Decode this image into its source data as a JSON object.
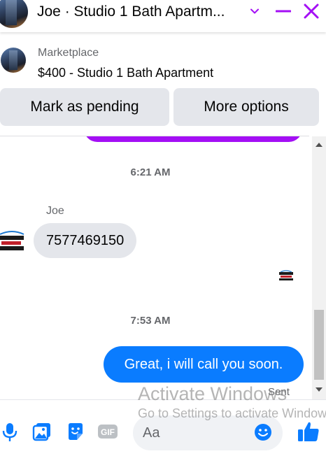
{
  "header": {
    "title": "Joe · Studio 1 Bath Apartm...",
    "accent_color": "#a40ff5"
  },
  "listing": {
    "kind": "Marketplace",
    "title": "$400 - Studio 1 Bath Apartment"
  },
  "actions": {
    "mark_pending": "Mark as pending",
    "more_options": "More options"
  },
  "chat": {
    "timestamp_1": "6:21 AM",
    "sender_name": "Joe",
    "received_message": "7577469150",
    "timestamp_2": "7:53 AM",
    "sent_message": "Great, i will call you soon.",
    "status": "Sent",
    "sent_bubble_color": "#0a7cff"
  },
  "composer": {
    "placeholder": "Aa",
    "icons": [
      "microphone-icon",
      "photo-icon",
      "sticker-icon",
      "gif-icon",
      "emoji-icon",
      "thumbs-up-icon"
    ]
  },
  "watermark": {
    "line1": "Activate Windows",
    "line2": "Go to Settings to activate Windows."
  }
}
